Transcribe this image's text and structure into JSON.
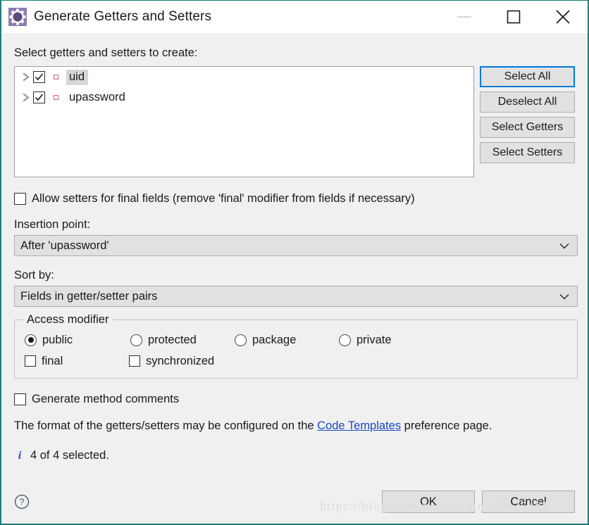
{
  "window": {
    "title": "Generate Getters and Setters",
    "icon": "gear-icon",
    "minimize_label": "Minimize",
    "maximize_label": "Maximize",
    "close_label": "Close"
  },
  "main": {
    "select_label": "Select getters and setters to create:",
    "tree_items": [
      {
        "label": "uid",
        "checked": true,
        "selected": true,
        "icon": "field-icon"
      },
      {
        "label": "upassword",
        "checked": true,
        "selected": false,
        "icon": "field-icon"
      }
    ],
    "side_buttons": [
      {
        "label": "Select All",
        "focused": true
      },
      {
        "label": "Deselect All",
        "focused": false
      },
      {
        "label": "Select Getters",
        "focused": false
      },
      {
        "label": "Select Setters",
        "focused": false
      }
    ],
    "allow_final": {
      "label": "Allow setters for final fields (remove 'final' modifier from fields if necessary)",
      "checked": false
    },
    "insertion_point": {
      "label": "Insertion point:",
      "value": "After 'upassword'"
    },
    "sort_by": {
      "label": "Sort by:",
      "value": "Fields in getter/setter pairs"
    },
    "access_modifier": {
      "title": "Access modifier",
      "radios": [
        {
          "label": "public",
          "checked": true
        },
        {
          "label": "protected",
          "checked": false
        },
        {
          "label": "package",
          "checked": false
        },
        {
          "label": "private",
          "checked": false
        }
      ],
      "checkboxes": [
        {
          "label": "final",
          "checked": false
        },
        {
          "label": "synchronized",
          "checked": false
        }
      ]
    },
    "generate_comments": {
      "label": "Generate method comments",
      "checked": false
    },
    "format_note": {
      "prefix": "The format of the getters/setters may be configured on the ",
      "link": "Code Templates",
      "suffix": " preference page."
    },
    "status": {
      "icon": "info-icon",
      "text": "4 of 4 selected."
    }
  },
  "footer": {
    "help_label": "?",
    "ok_label": "OK",
    "cancel_label": "Cancel"
  },
  "watermark": "https://blog.csdn.net/weixin_40425481",
  "colors": {
    "dialog_border": "#1b7f7a",
    "panel_bg": "#f0f0f0",
    "list_bg": "#ffffff",
    "button_bg": "#e1e1e1",
    "focus_blue": "#0078d7",
    "link_blue": "#1749c4",
    "field_icon_red": "#d4616d",
    "selection_gray": "#d6d6d6"
  }
}
